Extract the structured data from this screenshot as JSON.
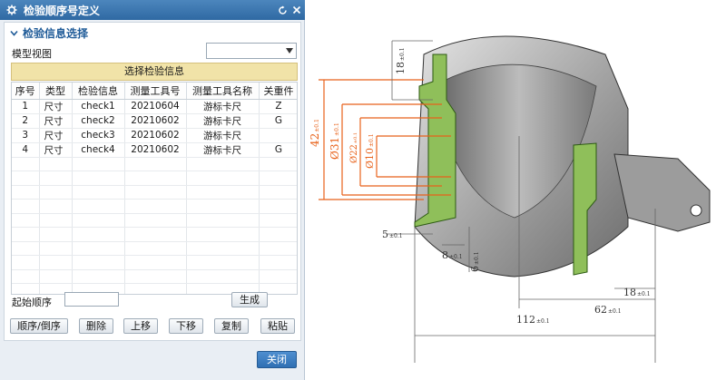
{
  "window": {
    "title": "检验顺序号定义"
  },
  "section": {
    "title": "检验信息选择"
  },
  "model_view": {
    "label": "模型视图",
    "value": ""
  },
  "banner": {
    "label": "选择检验信息"
  },
  "table": {
    "columns": [
      "序号",
      "类型",
      "检验信息",
      "测量工具号",
      "测量工具名称",
      "关重件"
    ],
    "rows": [
      [
        "1",
        "尺寸",
        "check1",
        "20210604",
        "游标卡尺",
        "Z"
      ],
      [
        "2",
        "尺寸",
        "check2",
        "20210602",
        "游标卡尺",
        "G"
      ],
      [
        "3",
        "尺寸",
        "check3",
        "20210602",
        "游标卡尺",
        ""
      ],
      [
        "4",
        "尺寸",
        "check4",
        "20210602",
        "游标卡尺",
        "G"
      ]
    ]
  },
  "start_order": {
    "label": "起始顺序",
    "value": ""
  },
  "buttons": {
    "generate": "生成",
    "order_reverse": "顺序/倒序",
    "delete": "删除",
    "move_up": "上移",
    "move_down": "下移",
    "copy": "复制",
    "paste": "粘贴",
    "close": "关闭"
  },
  "drawing": {
    "dims": [
      {
        "value": "18",
        "tol": "±0.1"
      },
      {
        "value": "42",
        "tol": "±0.1"
      },
      {
        "value": "Ø31",
        "tol": "±0.1"
      },
      {
        "value": "Ø22",
        "tol": "±0.1"
      },
      {
        "value": "Ø10",
        "tol": "±0.1"
      },
      {
        "value": "5",
        "tol": "±0.1"
      },
      {
        "value": "8",
        "tol": "±0.1"
      },
      {
        "value": "6",
        "tol": "±0.1"
      },
      {
        "value": "18",
        "tol": "±0.1"
      },
      {
        "value": "62",
        "tol": "±0.1"
      },
      {
        "value": "112",
        "tol": "±0.1"
      }
    ]
  }
}
